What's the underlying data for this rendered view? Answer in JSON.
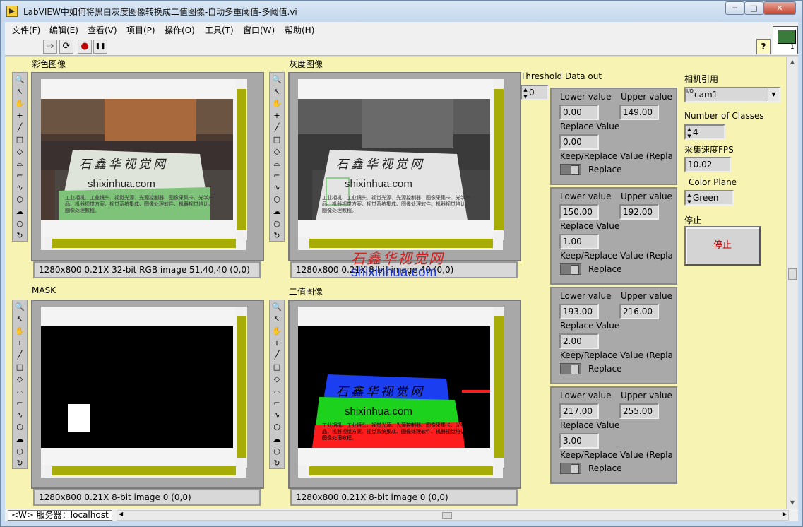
{
  "window": {
    "title": "LabVIEW中如何将黑白灰度图像转换成二值图像-自动多重阈值-多阈值.vi",
    "minimize_glyph": "─",
    "maximize_glyph": "□",
    "close_glyph": "✕"
  },
  "menu": [
    "文件(F)",
    "编辑(E)",
    "查看(V)",
    "项目(P)",
    "操作(O)",
    "工具(T)",
    "窗口(W)",
    "帮助(H)"
  ],
  "toolbar": {
    "run_glyph": "⇨",
    "run_continuous_glyph": "⟳",
    "abort_glyph": "●",
    "pause_glyph": "❚❚",
    "help_glyph": "?"
  },
  "palette_tools": [
    "zoom-icon",
    "pointer-icon",
    "pan-icon",
    "crosshair-icon",
    "line-icon",
    "rectangle-icon",
    "rotated-rect-icon",
    "annulus-icon",
    "polyline-icon",
    "freehand-line-icon",
    "polygon-icon",
    "freehand-region-icon",
    "oval-icon",
    "broken-line-icon"
  ],
  "palette_glyphs": [
    "🔍",
    "↖",
    "✋",
    "+",
    "╱",
    "□",
    "◇",
    "⌓",
    "⌐",
    "∿",
    "⬡",
    "☁",
    "○",
    "↻"
  ],
  "displays": {
    "color": {
      "label": "彩色图像",
      "info": "1280x800 0.21X 32-bit RGB image 51,40,40     (0,0)"
    },
    "gray": {
      "label": "灰度图像",
      "info": "1280x800 0.21X 8-bit image 40     (0,0)"
    },
    "mask": {
      "label": "MASK",
      "info": "1280x800 0.21X 8-bit image 0     (0,0)"
    },
    "binary": {
      "label": "二值图像",
      "info": "1280x800 0.21X 8-bit image 0     (0,0)"
    }
  },
  "card": {
    "title_cn": "石鑫华视觉网",
    "site": "shixinhua.com",
    "body_cn": "工业相机、工业镜头、视觉光源、光源控制器、图像采集卡、光学产品、机器视觉方案、视觉系统集成、图像处理软件、机器视觉培训、图像处理教程。"
  },
  "watermark": {
    "cn": "石鑫华视觉网",
    "en": "shixinhua.com"
  },
  "threshold": {
    "label": "Threshold Data out",
    "index": "0",
    "lower_label": "Lower value",
    "upper_label": "Upper value",
    "replace_label": "Replace Value",
    "keep_label": "Keep/Replace Value (Repla",
    "toggle_label": "Replace",
    "clusters": [
      {
        "lower": "0.00",
        "upper": "149.00",
        "replace": "0.00"
      },
      {
        "lower": "150.00",
        "upper": "192.00",
        "replace": "1.00"
      },
      {
        "lower": "193.00",
        "upper": "216.00",
        "replace": "2.00"
      },
      {
        "lower": "217.00",
        "upper": "255.00",
        "replace": "3.00"
      }
    ]
  },
  "controls": {
    "camera_label": "相机引用",
    "camera_value": "cam1",
    "camera_prefix": "I/O",
    "classes_label": "Number of Classes",
    "classes_value": "4",
    "fps_label": "采集速度FPS",
    "fps_value": "10.02",
    "plane_label": "Color Plane",
    "plane_value": "Green",
    "stop_label": "停止",
    "stop_button": "停止"
  },
  "statusbar": {
    "server": "<W> 服务器：localhost"
  },
  "colors": {
    "panel_bg": "#f7f4b3",
    "scroll_accent": "#a7ad06",
    "stop_text": "#c00000"
  }
}
